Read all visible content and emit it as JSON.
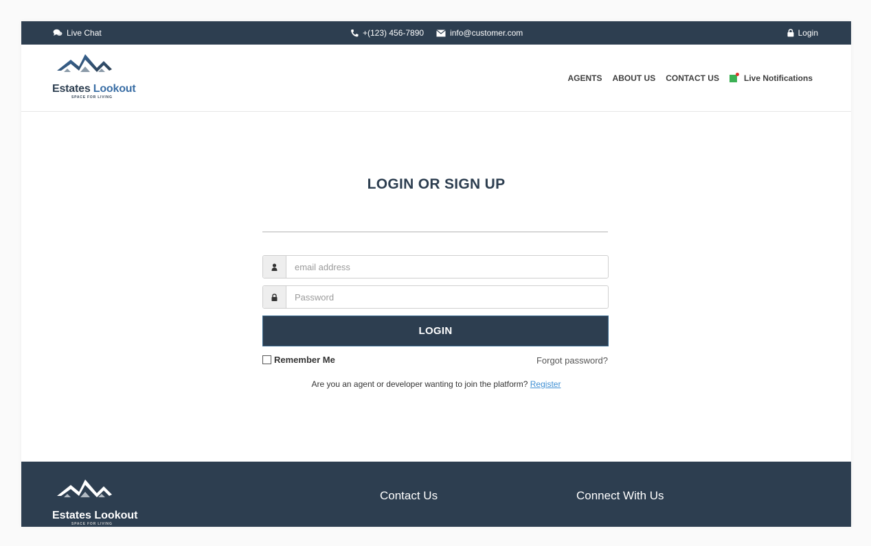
{
  "topbar": {
    "live_chat": "Live Chat",
    "phone": "+(123) 456-7890",
    "email": "info@customer.com",
    "login": "Login"
  },
  "brand": {
    "name_part1": "Estates",
    "name_part2": "Lookout",
    "tagline": "SPACE FOR LIVING"
  },
  "nav": {
    "items": [
      "AGENTS",
      "ABOUT US",
      "CONTACT US"
    ],
    "notifications": "Live Notifications"
  },
  "form": {
    "title": "LOGIN OR SIGN UP",
    "email_placeholder": "email address",
    "password_placeholder": "Password",
    "login_button": "LOGIN",
    "remember_me": "Remember Me",
    "forgot_password": "Forgot password?",
    "register_prompt": "Are you an agent or developer wanting to join the platform?",
    "register_link": "Register"
  },
  "footer": {
    "brand": "Estates Lookout",
    "tagline": "SPACE FOR LIVING",
    "contact_heading": "Contact Us",
    "connect_heading": "Connect With Us"
  },
  "colors": {
    "primary": "#2d3e50",
    "brand_blue": "#3a6ea5",
    "link": "#3d8ed3",
    "notification_green": "#3cb054",
    "notification_dot": "#e0302c"
  }
}
